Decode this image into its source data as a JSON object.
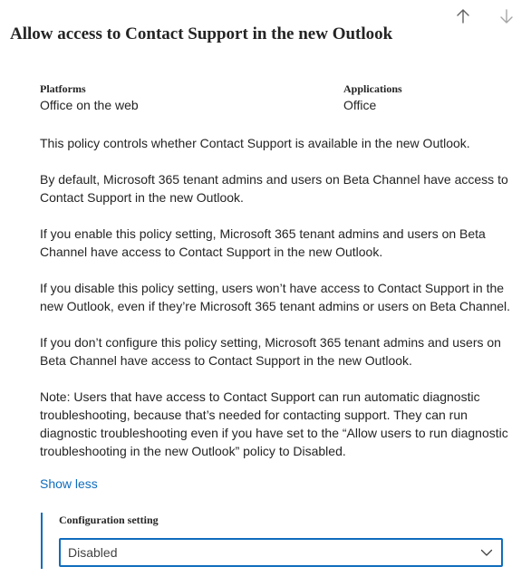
{
  "nav": {
    "up_icon": "arrow-up-icon",
    "down_icon": "arrow-down-icon"
  },
  "title": "Allow access to Contact Support in the new Outlook",
  "meta": {
    "platforms_label": "Platforms",
    "platforms_value": "Office on the web",
    "applications_label": "Applications",
    "applications_value": "Office"
  },
  "description": [
    "This policy controls whether Contact Support is available in the new Outlook.",
    "By default, Microsoft 365 tenant admins and users on Beta Channel have access to Contact Support in the new Outlook.",
    "If you enable this policy setting, Microsoft 365 tenant admins and users on Beta Channel have access to Contact Support in the new Outlook.",
    "If you disable this policy setting, users won’t have access to Contact Support in the new Outlook, even if they’re Microsoft 365 tenant admins or users on Beta Channel.",
    "If you don’t configure this policy setting, Microsoft 365 tenant admins and users on Beta Channel have access to Contact Support in the new Outlook.",
    "Note: Users that have access to Contact Support can run automatic diagnostic troubleshooting, because that’s needed for contacting support. They can run diagnostic troubleshooting even if you have set to the “Allow users to run diagnostic troubleshooting in the new Outlook” policy to Disabled."
  ],
  "show_less_label": "Show less",
  "config": {
    "label": "Configuration setting",
    "selected_value": "Disabled",
    "dropdown_icon": "chevron-down-icon"
  },
  "colors": {
    "accent": "#0f6cbd",
    "text": "#242424",
    "icon_gray": "#8a8a8a"
  }
}
